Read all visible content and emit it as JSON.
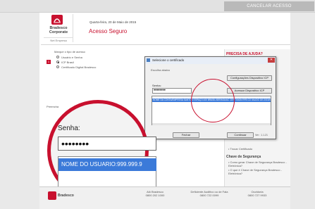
{
  "topbar": {
    "cancel_label": "CANCELAR ACESSO"
  },
  "header": {
    "brand_line1": "Bradesco",
    "brand_line2": "Corporate",
    "subtitle": "Net Empresa",
    "date": "Quarta-feira, 20 de Maio de 2015",
    "title": "Acesso Seguro"
  },
  "step": {
    "number": "1",
    "prompt": "Marque o tipo de acesso",
    "options": [
      "Usuário e Senha",
      "ICP Brasil",
      "Certificado Digital Bradesco"
    ],
    "selected_index": 1,
    "below_label": "Preencha"
  },
  "right_panel": {
    "title": "PRECISA DE AJUDA?",
    "item": "• Trocar Certificado",
    "section": "Chave de Segurança",
    "links": [
      "• Como gerar Chave de Segurança Bradesco - Eletrônica?",
      "• O que é Chave de Segurança Bradesco - Eletrônica?"
    ]
  },
  "dialog": {
    "title": "Selecione o certificado",
    "group_label": "Escolha abaixo",
    "config_button": "Configurações Dispositivo ICP",
    "password_label": "Senha:",
    "password_value": "••••••••",
    "access_button": "Acessar Dispositivo ICP",
    "selected_entry": "NOME DA CONTA/EMPRESA SANTOS ESPAÇO:100 BRASIL/SERASA/AC CERTISIGN RFB G3 VALIDO DE:2015/05/20 ATÉ:2016/05/20",
    "close_button": "Fechar",
    "continue_button": "Continuar",
    "version": "Ver : 1.1.21"
  },
  "magnifier": {
    "label": "Senha:",
    "password_value": "••••••••",
    "selected_entry": "NOME DO USUARIO:999.999.9"
  },
  "footer": {
    "brand": "Bradesco",
    "cols": [
      {
        "title": "Alô Bradesco",
        "phone": "0800 202 1000"
      },
      {
        "title": "Deficiente Auditivo ou de Fala",
        "phone": "0800 722 0099"
      },
      {
        "title": "Ouvidoria",
        "phone": "0800 727 9933"
      }
    ]
  },
  "colors": {
    "brand_red": "#c8102e",
    "selection_blue": "#3b7ad9"
  }
}
